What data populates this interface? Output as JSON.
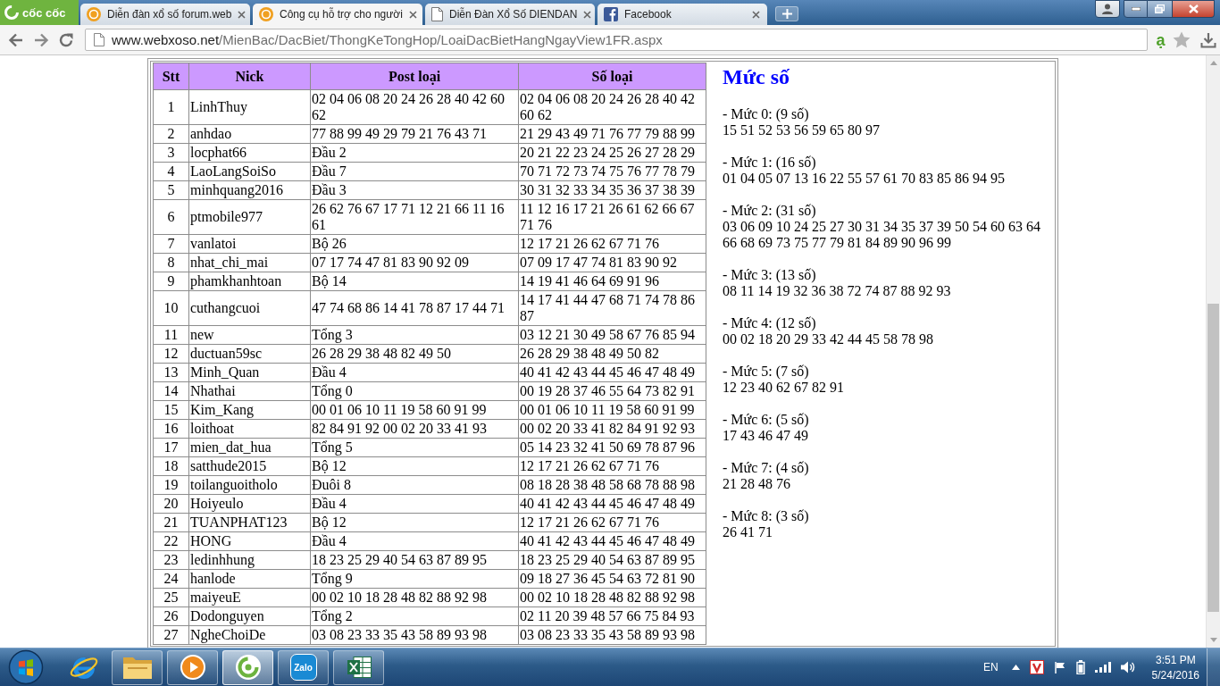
{
  "browser": {
    "menu_label": "cốc cốc",
    "tabs": [
      {
        "kind": "xs",
        "title": "Diễn đàn xổ số forum.web",
        "selected": false
      },
      {
        "kind": "xs",
        "title": "Công cụ hỗ trợ cho người",
        "selected": true
      },
      {
        "kind": "page",
        "title": "Diễn Đàn Xổ Số DIENDAN",
        "selected": false
      },
      {
        "kind": "facebook",
        "title": "Facebook",
        "selected": false
      }
    ],
    "address": {
      "host": "www.webxoso.net",
      "path": "/MienBac/DacBiet/ThongKeTongHop/LoaiDacBietHangNgayView1FR.aspx"
    },
    "extension_label": "ạ"
  },
  "table": {
    "columns": [
      "Stt",
      "Nick",
      "Post loại",
      "Số loại"
    ],
    "rows": [
      [
        "1",
        "LinhThuy",
        "02 04 06 08 20 24 26 28 40 42 60 62",
        "02 04 06 08 20 24 26 28 40 42 60 62"
      ],
      [
        "2",
        "anhdao",
        "77 88 99 49 29 79 21 76 43 71",
        "21 29 43 49 71 76 77 79 88 99"
      ],
      [
        "3",
        "locphat66",
        "Đầu 2",
        "20 21 22 23 24 25 26 27 28 29"
      ],
      [
        "4",
        "LaoLangSoiSo",
        "Đầu 7",
        "70 71 72 73 74 75 76 77 78 79"
      ],
      [
        "5",
        "minhquang2016",
        "Đầu 3",
        "30 31 32 33 34 35 36 37 38 39"
      ],
      [
        "6",
        "ptmobile977",
        "26 62 76 67 17 71 12 21 66 11 16 61",
        "11 12 16 17 21 26 61 62 66 67 71 76"
      ],
      [
        "7",
        "vanlatoi",
        "Bộ 26",
        "12 17 21 26 62 67 71 76"
      ],
      [
        "8",
        "nhat_chi_mai",
        "07 17 74 47 81 83 90 92 09",
        "07 09 17 47 74 81 83 90 92"
      ],
      [
        "9",
        "phamkhanhtoan",
        "Bộ 14",
        "14 19 41 46 64 69 91 96"
      ],
      [
        "10",
        "cuthangcuoi",
        "47 74 68 86 14 41 78 87 17 44 71",
        "14 17 41 44 47 68 71 74 78 86 87"
      ],
      [
        "11",
        "new",
        "Tổng 3",
        "03 12 21 30 49 58 67 76 85 94"
      ],
      [
        "12",
        "ductuan59sc",
        "26 28 29 38 48 82 49 50",
        "26 28 29 38 48 49 50 82"
      ],
      [
        "13",
        "Minh_Quan",
        "Đầu 4",
        "40 41 42 43 44 45 46 47 48 49"
      ],
      [
        "14",
        "Nhathai",
        "Tổng 0",
        "00 19 28 37 46 55 64 73 82 91"
      ],
      [
        "15",
        "Kim_Kang",
        "00 01 06 10 11 19 58 60 91 99",
        "00 01 06 10 11 19 58 60 91 99"
      ],
      [
        "16",
        "loithoat",
        "82 84 91 92 00 02 20 33 41 93",
        "00 02 20 33 41 82 84 91 92 93"
      ],
      [
        "17",
        "mien_dat_hua",
        "Tổng 5",
        "05 14 23 32 41 50 69 78 87 96"
      ],
      [
        "18",
        "satthude2015",
        "Bộ 12",
        "12 17 21 26 62 67 71 76"
      ],
      [
        "19",
        "toilanguoitholo",
        "Đuôi 8",
        "08 18 28 38 48 58 68 78 88 98"
      ],
      [
        "20",
        "Hoiyeulo",
        "Đầu 4",
        "40 41 42 43 44 45 46 47 48 49"
      ],
      [
        "21",
        "TUANPHAT123",
        "Bộ 12",
        "12 17 21 26 62 67 71 76"
      ],
      [
        "22",
        "HONG",
        "Đầu 4",
        "40 41 42 43 44 45 46 47 48 49"
      ],
      [
        "23",
        "ledinhhung",
        "18 23 25 29 40 54 63 87 89 95",
        "18 23 25 29 40 54 63 87 89 95"
      ],
      [
        "24",
        "hanlode",
        "Tổng 9",
        "09 18 27 36 45 54 63 72 81 90"
      ],
      [
        "25",
        "maiyeuE",
        "00 02 10 18 28 48 82 88 92 98",
        "00 02 10 18 28 48 82 88 92 98"
      ],
      [
        "26",
        "Dodonguyen",
        "Tổng 2",
        "02 11 20 39 48 57 66 75 84 93"
      ],
      [
        "27",
        "NgheChoiDe",
        "03 08 23 33 35 43 58 89 93 98",
        "03 08 23 33 35 43 58 89 93 98"
      ]
    ]
  },
  "levels": {
    "title": "Mức số",
    "groups": [
      {
        "label": "- Mức 0: (9 số)",
        "numbers": "15 51 52 53 56 59 65 80 97"
      },
      {
        "label": "- Mức 1: (16 số)",
        "numbers": "01 04 05 07 13 16 22 55 57 61 70 83 85 86 94 95"
      },
      {
        "label": "- Mức 2: (31 số)",
        "numbers": "03 06 09 10 24 25 27 30 31 34 35 37 39 50 54 60 63 64 66 68 69 73 75 77 79 81 84 89 90 96 99"
      },
      {
        "label": "- Mức 3: (13 số)",
        "numbers": "08 11 14 19 32 36 38 72 74 87 88 92 93"
      },
      {
        "label": "- Mức 4: (12 số)",
        "numbers": "00 02 18 20 29 33 42 44 45 58 78 98"
      },
      {
        "label": "- Mức 5: (7 số)",
        "numbers": "12 23 40 62 67 82 91"
      },
      {
        "label": "- Mức 6: (5 số)",
        "numbers": "17 43 46 47 49"
      },
      {
        "label": "- Mức 7: (4 số)",
        "numbers": "21 28 48 76"
      },
      {
        "label": "- Mức 8: (3 số)",
        "numbers": "26 41 71"
      }
    ]
  },
  "taskbar": {
    "apps": [
      {
        "kind": "ie",
        "running": false,
        "selected": false
      },
      {
        "kind": "explorer",
        "running": true,
        "selected": false
      },
      {
        "kind": "media",
        "running": true,
        "selected": false
      },
      {
        "kind": "coccoc",
        "running": true,
        "selected": true
      },
      {
        "kind": "zalo",
        "label": "Zalo",
        "running": true,
        "selected": false
      },
      {
        "kind": "excel",
        "running": true,
        "selected": false
      }
    ],
    "language": "EN",
    "time": "3:51 PM",
    "date": "5/24/2016"
  }
}
